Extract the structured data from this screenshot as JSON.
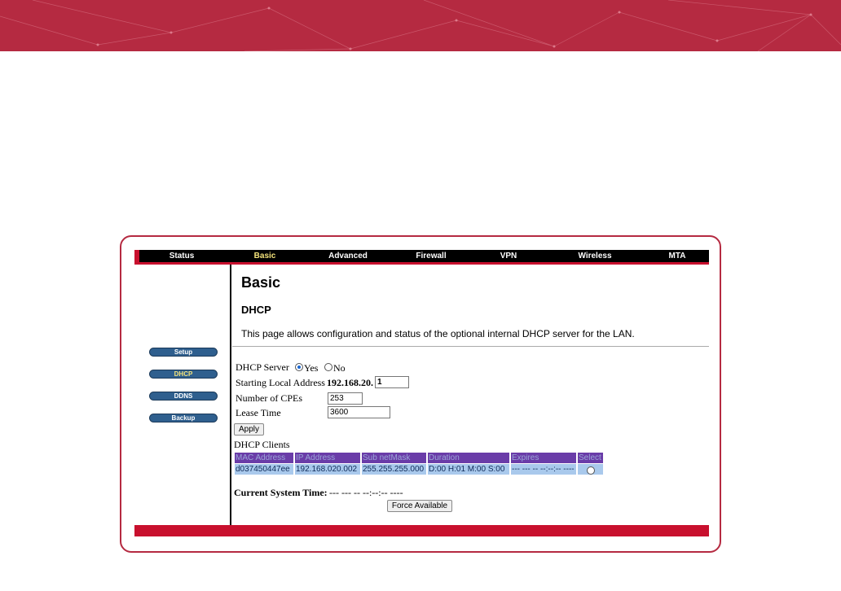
{
  "nav": {
    "tabs": [
      {
        "label": "Status"
      },
      {
        "label": "Basic"
      },
      {
        "label": "Advanced"
      },
      {
        "label": "Firewall"
      },
      {
        "label": "VPN"
      },
      {
        "label": "Wireless"
      },
      {
        "label": "MTA"
      }
    ],
    "active": "Basic"
  },
  "sidebar": {
    "items": [
      {
        "label": "Setup"
      },
      {
        "label": "DHCP"
      },
      {
        "label": "DDNS"
      },
      {
        "label": "Backup"
      }
    ],
    "active": "DHCP"
  },
  "page": {
    "title": "Basic",
    "subtitle": "DHCP",
    "description": "This page allows configuration and status of the optional internal DHCP server for the LAN."
  },
  "form": {
    "dhcp_server_label": "DHCP Server",
    "yes_label": "Yes",
    "no_label": "No",
    "dhcp_server_value": "Yes",
    "start_addr_label": "Starting Local Address",
    "start_addr_prefix": "192.168.20.",
    "start_addr_value": "1",
    "num_cpes_label": "Number of CPEs",
    "num_cpes_value": "253",
    "lease_time_label": "Lease Time",
    "lease_time_value": "3600",
    "apply_label": "Apply"
  },
  "clients": {
    "title": "DHCP Clients",
    "columns": [
      "MAC Address",
      "IP Address",
      "Sub netMask",
      "Duration",
      "Expires",
      "Select"
    ],
    "rows": [
      [
        "d037450447ee",
        "192.168.020.002",
        "255.255.255.000",
        "D:00 H:01 M:00 S:00",
        "--- --- -- --:--:-- ----",
        ""
      ]
    ]
  },
  "system_time": {
    "label": "Current System Time:",
    "value": "--- --- -- --:--:-- ----"
  },
  "force_available_label": "Force Available",
  "colors": {
    "banner": "#b52a41",
    "accent_red": "#c8102e",
    "active_tab_text": "#f3e27a",
    "table_header_bg": "#6a3ca8",
    "table_cell_bg": "#a9c9ec"
  }
}
